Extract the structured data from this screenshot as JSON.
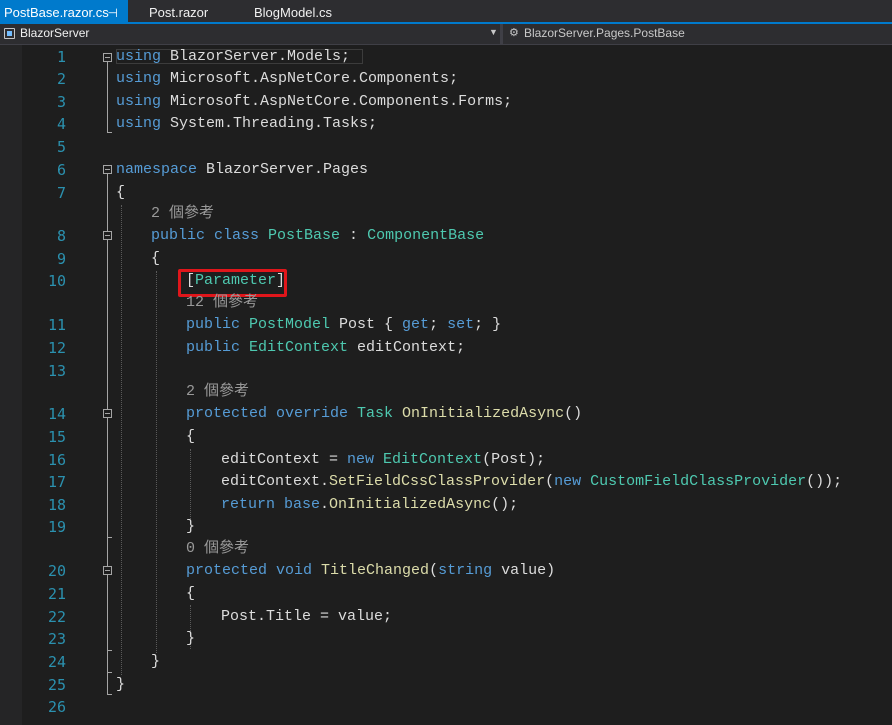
{
  "tabs": [
    {
      "label": "PostBase.razor.cs",
      "pin": "⊣"
    },
    {
      "label": "Post.razor"
    },
    {
      "label": "BlogModel.cs"
    }
  ],
  "nav": {
    "project": "BlazorServer",
    "member": "BlazorServer.Pages.PostBase"
  },
  "colors": {
    "keyword": "#569cd6",
    "type": "#4ec9b0",
    "method": "#dcdcaa",
    "line_number": "#2b91af",
    "highlight_box": "#e0161b",
    "accent": "#007acc"
  },
  "editor": {
    "line_numbers": [
      "1",
      "2",
      "3",
      "4",
      "5",
      "6",
      "7",
      "8",
      "9",
      "10",
      "11",
      "12",
      "13",
      "14",
      "15",
      "16",
      "17",
      "18",
      "19",
      "20",
      "21",
      "22",
      "23",
      "24",
      "25",
      "26"
    ],
    "lens": {
      "class_refs": "2 個參考",
      "post_refs": "12 個參考",
      "oninit_refs": "2 個參考",
      "title_refs": "0 個參考"
    },
    "code": {
      "l1": [
        "using",
        " BlazorServer.Models;"
      ],
      "l2": [
        "using",
        " Microsoft.AspNetCore.Components;"
      ],
      "l3": [
        "using",
        " Microsoft.AspNetCore.Components.Forms;"
      ],
      "l4": [
        "using",
        " System.Threading.Tasks;"
      ],
      "l6": [
        "namespace",
        " BlazorServer.Pages"
      ],
      "l7": "{",
      "l8": [
        "public",
        " class",
        " PostBase",
        " : ",
        "ComponentBase"
      ],
      "l9": "{",
      "l10": [
        "[",
        "Parameter",
        "]"
      ],
      "l11": [
        "public",
        " PostModel",
        " Post { ",
        "get",
        "; ",
        "set",
        "; }"
      ],
      "l12": [
        "public",
        " EditContext",
        " editContext;"
      ],
      "l14": [
        "protected",
        " override",
        " Task",
        " OnInitializedAsync",
        "()"
      ],
      "l15": "{",
      "l16": [
        "editContext = ",
        "new",
        " EditContext",
        "(Post);"
      ],
      "l17": [
        "editContext.",
        "SetFieldCssClassProvider",
        "(",
        "new",
        " CustomFieldClassProvider",
        "());"
      ],
      "l18": [
        "return",
        " base",
        ".",
        "OnInitializedAsync",
        "();"
      ],
      "l19": "}",
      "l20": [
        "protected",
        " void",
        " TitleChanged",
        "(",
        "string",
        " value",
        ")"
      ],
      "l21": "{",
      "l22": [
        "Post.Title = ",
        "value",
        ";"
      ],
      "l23": "}",
      "l24": "}",
      "l25": "}"
    }
  }
}
